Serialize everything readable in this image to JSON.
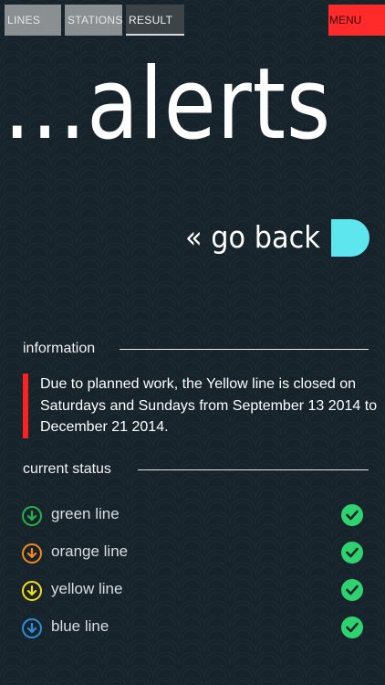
{
  "tabs": [
    {
      "label": "LINES"
    },
    {
      "label": "STATIONS"
    },
    {
      "label": "RESULT"
    }
  ],
  "menu_label": "MENU",
  "title": "...alerts",
  "go_back_label": "« go back",
  "information": {
    "heading": "information",
    "text": "Due to planned work, the Yellow line is closed on Saturdays and Sundays from September 13 2014 to December 21 2014."
  },
  "status": {
    "heading": "current status",
    "lines": [
      {
        "label": "green line",
        "color": "#27b34a",
        "icon": "arrow-down-circle-icon",
        "status_icon": "check-circle-icon"
      },
      {
        "label": "orange line",
        "color": "#f5891f",
        "icon": "arrow-down-circle-icon",
        "status_icon": "check-circle-icon"
      },
      {
        "label": "yellow line",
        "color": "#f4dc1b",
        "icon": "arrow-down-circle-icon",
        "status_icon": "check-circle-icon"
      },
      {
        "label": "blue line",
        "color": "#2a8fd6",
        "icon": "arrow-down-circle-icon",
        "status_icon": "check-circle-icon"
      }
    ]
  },
  "colors": {
    "background": "#17232b",
    "menu": "#ff2a2a",
    "accent_cyan": "#5ee6ee",
    "alert_bar": "#ff2020",
    "check": "#2ed36f"
  }
}
